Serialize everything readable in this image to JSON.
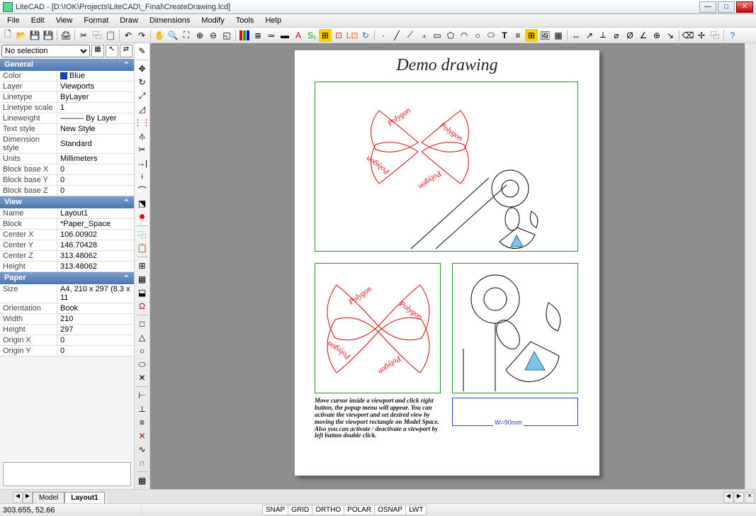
{
  "window": {
    "title": "LiteCAD - [D:\\!OK\\Projects\\LiteCAD\\_Final\\CreateDrawing.lcd]"
  },
  "menu": [
    "File",
    "Edit",
    "View",
    "Format",
    "Draw",
    "Dimensions",
    "Modify",
    "Tools",
    "Help"
  ],
  "selection": {
    "value": "No selection"
  },
  "panels": {
    "general": {
      "title": "General",
      "rows": [
        {
          "k": "Color",
          "v": "Blue",
          "color": true
        },
        {
          "k": "Layer",
          "v": "Viewports"
        },
        {
          "k": "Linetype",
          "v": "ByLayer"
        },
        {
          "k": "Linetype scale",
          "v": "1"
        },
        {
          "k": "Lineweight",
          "v": "——— By Layer"
        },
        {
          "k": "Text style",
          "v": "New Style"
        },
        {
          "k": "Dimension style",
          "v": "Standard"
        },
        {
          "k": "Units",
          "v": "Millimeters"
        },
        {
          "k": "Block base X",
          "v": "0"
        },
        {
          "k": "Block base Y",
          "v": "0"
        },
        {
          "k": "Block base Z",
          "v": "0"
        }
      ]
    },
    "view": {
      "title": "View",
      "rows": [
        {
          "k": "Name",
          "v": "Layout1"
        },
        {
          "k": "Block",
          "v": "*Paper_Space"
        },
        {
          "k": "Center X",
          "v": "106.00902"
        },
        {
          "k": "Center Y",
          "v": "146.70428"
        },
        {
          "k": "Center Z",
          "v": "313.48062"
        },
        {
          "k": "Height",
          "v": "313.48062"
        }
      ]
    },
    "paper": {
      "title": "Paper",
      "rows": [
        {
          "k": "Size",
          "v": "A4, 210 x 297 (8.3 x 11"
        },
        {
          "k": "Orientation",
          "v": "Book"
        },
        {
          "k": "Width",
          "v": "210"
        },
        {
          "k": "Height",
          "v": "297"
        },
        {
          "k": "Origin X",
          "v": "0"
        },
        {
          "k": "Origin Y",
          "v": "0"
        }
      ]
    }
  },
  "drawing": {
    "title": "Demo drawing",
    "polygon_label": "Polygon",
    "note": "Move cursor inside a viewport and click right button, the popup menu will appear. You can activate the viewport and set desired view by moving the viewport rectangle on Model Space.\nAlso you can activate / deactivate a viewport by left button double click.",
    "dim_label": "W=90mm"
  },
  "tabs": {
    "model": "Model",
    "layout": "Layout1"
  },
  "status": {
    "coord": "303.655,  52.66",
    "toggles": [
      "SNAP",
      "GRID",
      "ORTHO",
      "POLAR",
      "OSNAP",
      "LWT"
    ]
  }
}
